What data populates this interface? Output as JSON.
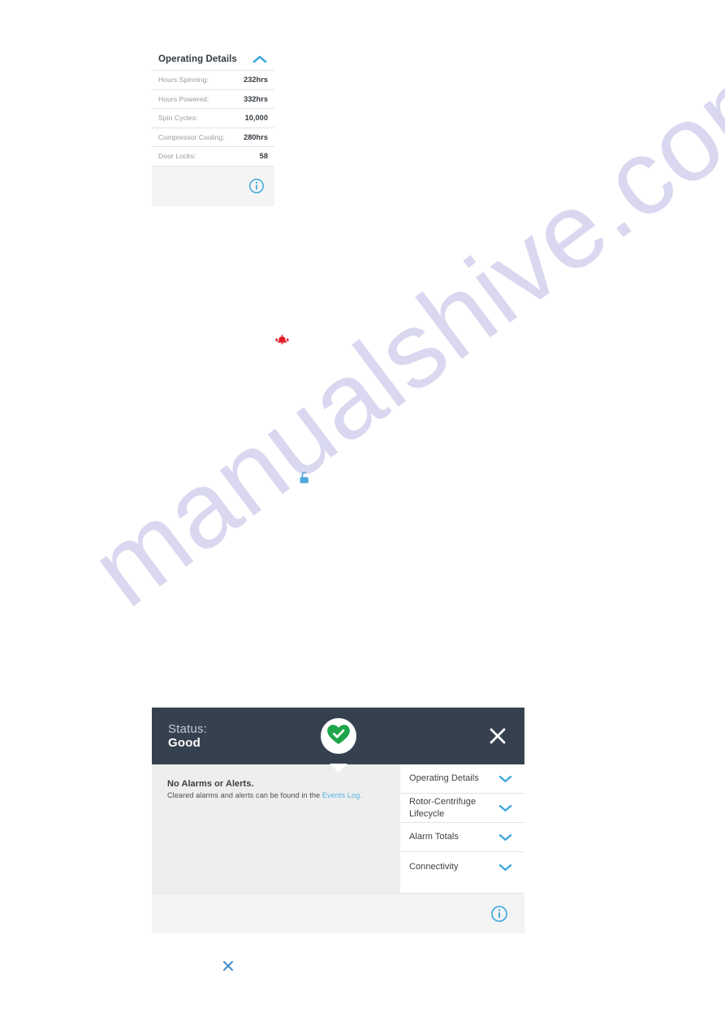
{
  "watermark": {
    "text": "manualshive.com",
    "color": "#d8d6f0"
  },
  "colors": {
    "accent_blue": "#3fa9dd",
    "link_blue": "#56b3e2",
    "header_dark": "#36414f",
    "status_green": "#1da64a",
    "alarm_red": "#e01b24",
    "panel_gray": "#eeeeee",
    "footer_gray": "#f4f4f4"
  },
  "operating_details_card": {
    "title": "Operating Details",
    "toggle_icon": "chevron-up-icon",
    "expanded": true,
    "rows": [
      {
        "label": "Hours Spinning:",
        "value": "232hrs"
      },
      {
        "label": "Hours Powered:",
        "value": "332hrs"
      },
      {
        "label": "Spin Cycles:",
        "value": "10,000"
      },
      {
        "label": "Compressor Cooling:",
        "value": "280hrs"
      },
      {
        "label": "Door Locks:",
        "value": "58"
      }
    ],
    "footer_icon": "info-icon"
  },
  "stray_icons": {
    "alarm_bell": "alarm-bell-icon",
    "unlocked_padlock": "unlocked-padlock-icon",
    "close": "close-icon"
  },
  "status_dialog": {
    "status_label": "Status:",
    "status_value": "Good",
    "status_badge_icon": "heart-check-icon",
    "close_icon": "close-icon",
    "alarms": {
      "title": "No Alarms or Alerts.",
      "subtitle_prefix": "Cleared alarms and alerts can be found in the ",
      "link_text": "Events Log.",
      "link_label": "Events Log."
    },
    "accordion": [
      {
        "label": "Operating Details",
        "icon": "chevron-down-icon"
      },
      {
        "label": "Rotor-Centrifuge Lifecycle",
        "icon": "chevron-down-icon"
      },
      {
        "label": "Alarm Totals",
        "icon": "chevron-down-icon"
      },
      {
        "label": "Connectivity",
        "icon": "chevron-down-icon"
      }
    ],
    "footer_icon": "info-icon"
  }
}
